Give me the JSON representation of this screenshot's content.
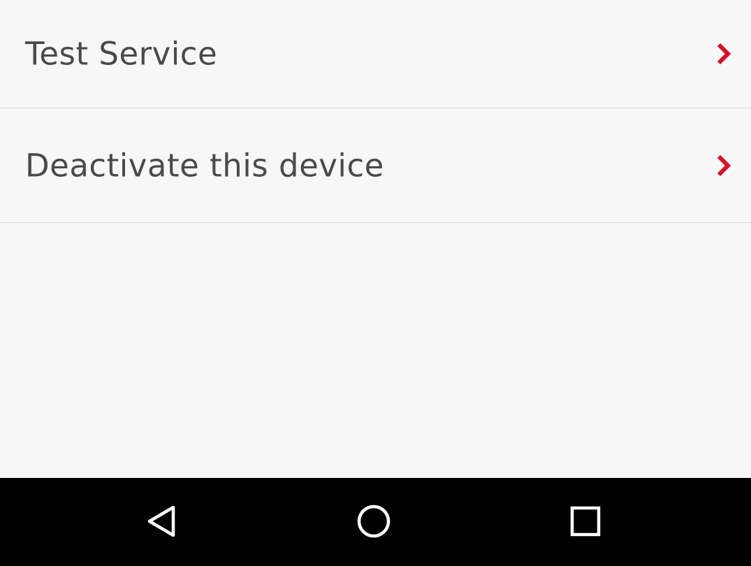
{
  "settings_list": {
    "items": [
      {
        "label": "Test Service",
        "icon": "chevron-right-icon"
      },
      {
        "label": "Deactivate this device",
        "icon": "chevron-right-icon"
      }
    ]
  },
  "navigation_bar": {
    "buttons": [
      {
        "icon": "back-triangle-icon"
      },
      {
        "icon": "home-circle-icon"
      },
      {
        "icon": "recents-square-icon"
      }
    ]
  },
  "colors": {
    "accent": "#d6102a",
    "background": "#f7f7f7",
    "text": "#4a4a4a",
    "divider": "#dcdcdc",
    "nav_bar": "#000000"
  }
}
